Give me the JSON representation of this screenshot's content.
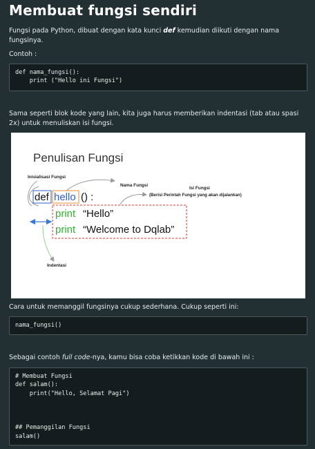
{
  "heading": "Membuat fungsi sendiri",
  "intro": {
    "part1": "Fungsi pada Python, dibuat dengan kata kunci ",
    "keyword": "def",
    "part2": " kemudian diikuti dengan nama fungsinya."
  },
  "example_label": "Contoh :",
  "code1": [
    "def nama_fungsi():",
    "    print (\"Hello ini Fungsi\")"
  ],
  "indent_note": "Sama seperti blok kode yang lain, kita juga harus memberikan indentasi (tab atau spasi 2x) untuk menuliskan isi fungsi.",
  "diagram": {
    "title": "Penulisan Fungsi",
    "label_init": "Inisialisasi Fungsi",
    "label_name": "Nama Fungsi",
    "label_body": "Isi Fungsi",
    "label_body_sub": "(Berisi Perintah Fungsi yang akan dijalankan)",
    "label_indent": "Indentasi",
    "code_def": "def",
    "code_name": "hello",
    "code_paren": "() :",
    "line1_kw": "print",
    "line1_str": "“Hello”",
    "line2_kw": "print",
    "line2_str": "“Welcome to Dqlab”",
    "colors": {
      "blue": "#2f5fd0",
      "orange": "#e88a2a",
      "green": "#34b233",
      "red": "#e03030",
      "gray": "#9a9a9a",
      "indent_arrow": "#3a78d8"
    }
  },
  "call_note": "Cara untuk memanggil fungsinya cukup sederhana. Cukup seperti ini:",
  "code2": [
    "nama_fungsi()"
  ],
  "full_note": {
    "part1": "Sebagai contoh ",
    "italic": "full code",
    "part2": "-nya, kamu bisa coba ketikkan kode di bawah ini :"
  },
  "code3": [
    "# Membuat Fungsi",
    "def salam():",
    "    print(\"Hello, Selamat Pagi\")",
    "",
    "",
    "",
    "## Pemanggilan Fungsi",
    "salam()"
  ]
}
